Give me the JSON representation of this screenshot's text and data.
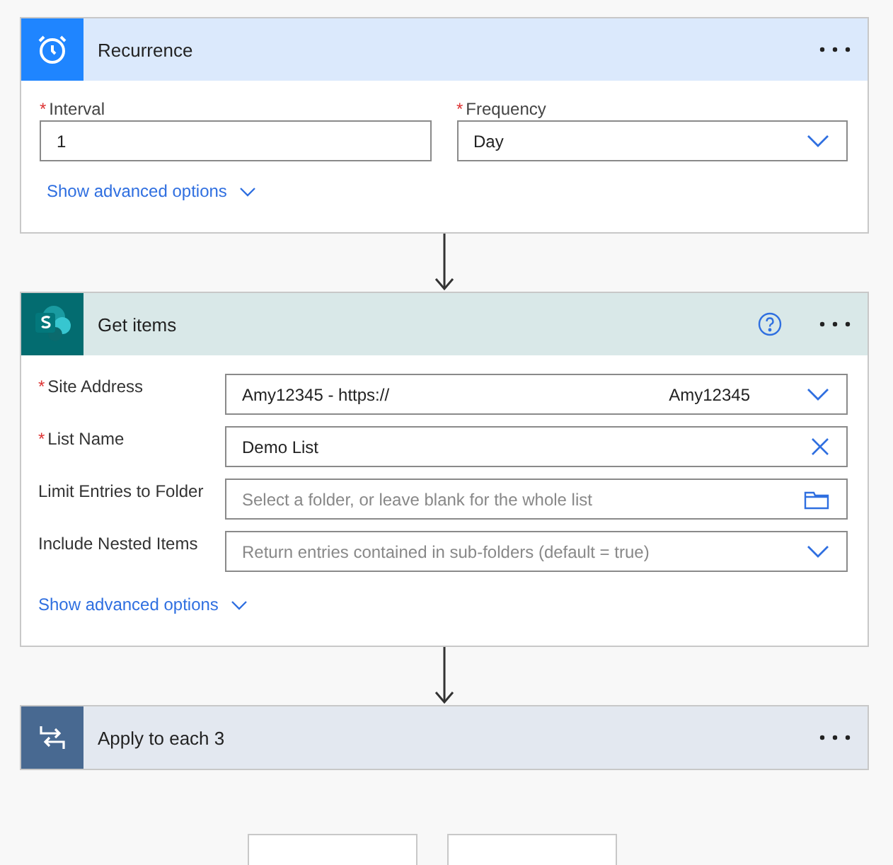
{
  "cards": [
    {
      "kind": "recurrence",
      "title": "Recurrence",
      "help": false,
      "fields": [
        {
          "label": "Interval",
          "required_mark": "*",
          "value": "1",
          "kind": "text"
        },
        {
          "label": "Frequency",
          "required_mark": "*",
          "value": "Day",
          "kind": "dropdown"
        }
      ],
      "advanced": "Show advanced options"
    },
    {
      "kind": "sharepoint",
      "title": "Get items",
      "help": true,
      "fields": [
        {
          "label": "Site Address",
          "required_mark": "*",
          "value": "Amy12345 - https://",
          "value_right": "Amy12345",
          "kind": "dropdown"
        },
        {
          "label": "List Name",
          "required_mark": "*",
          "value": "Demo List",
          "kind": "clear"
        },
        {
          "label": "Limit Entries to Folder",
          "placeholder": "Select a folder, or leave blank for the whole list",
          "kind": "folder"
        },
        {
          "label": "Include Nested Items",
          "placeholder": "Return entries contained in sub-folders (default = true)",
          "kind": "dropdown"
        }
      ],
      "advanced": "Show advanced options"
    },
    {
      "kind": "loop",
      "title": "Apply to each 3",
      "help": false
    }
  ]
}
